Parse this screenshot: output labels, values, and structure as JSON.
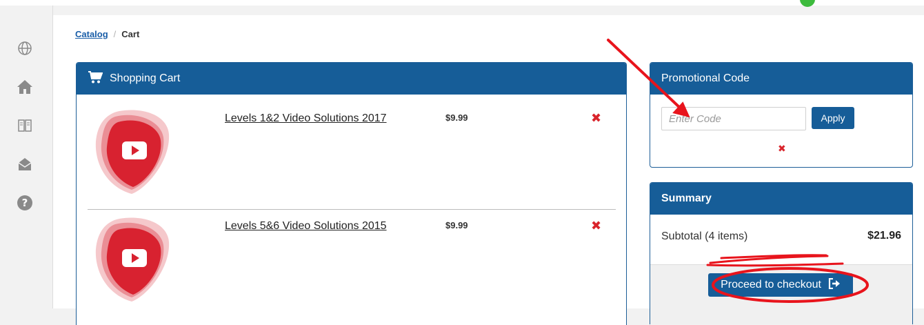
{
  "breadcrumb": {
    "parent": "Catalog",
    "separator": "/",
    "current": "Cart"
  },
  "sidebar": {
    "items": [
      {
        "icon": "globe-icon"
      },
      {
        "icon": "home-icon"
      },
      {
        "icon": "book-icon"
      },
      {
        "icon": "mail-icon"
      },
      {
        "icon": "help-icon"
      }
    ]
  },
  "cart": {
    "title": "Shopping Cart",
    "items": [
      {
        "title": "Levels 1&2 Video Solutions 2017",
        "price": "$9.99",
        "remove": "✖"
      },
      {
        "title": "Levels 5&6 Video Solutions 2015",
        "price": "$9.99",
        "remove": "✖"
      }
    ]
  },
  "promo": {
    "title": "Promotional Code",
    "input_placeholder": "Enter Code",
    "input_value": "",
    "apply_label": "Apply",
    "clear": "✖"
  },
  "summary": {
    "title": "Summary",
    "subtotal_label": "Subtotal (4 items)",
    "subtotal_value": "$21.96",
    "checkout_label": "Proceed to checkout"
  },
  "colors": {
    "brand_blue": "#165d98",
    "remove_red": "#d9242b",
    "annotation_red": "#e8141c",
    "youtube_red": "#d82230"
  }
}
